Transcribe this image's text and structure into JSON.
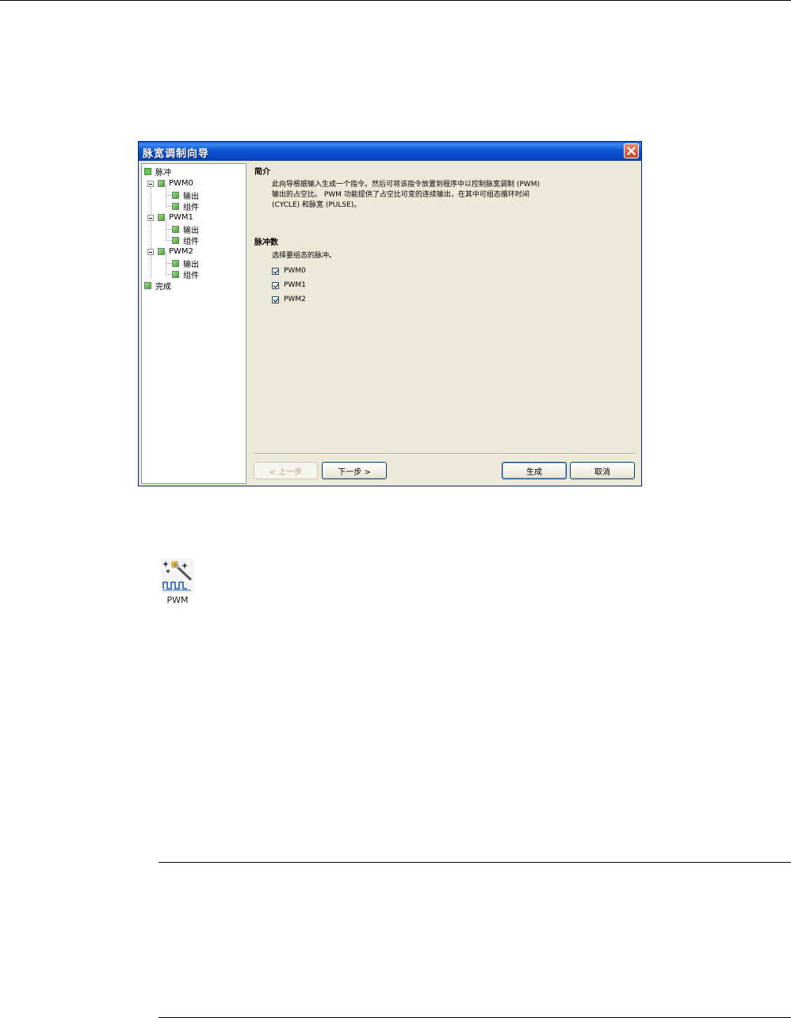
{
  "window": {
    "title": "脉宽调制向导",
    "tree": [
      {
        "label": "脉冲",
        "level": 0,
        "checked": true
      },
      {
        "label": "PWM0",
        "level": 1
      },
      {
        "label": "输出",
        "level": 2
      },
      {
        "label": "组件",
        "level": 2
      },
      {
        "label": "PWM1",
        "level": 1
      },
      {
        "label": "输出",
        "level": 2
      },
      {
        "label": "组件",
        "level": 2
      },
      {
        "label": "PWM2",
        "level": 1
      },
      {
        "label": "输出",
        "level": 2
      },
      {
        "label": "组件",
        "level": 2
      },
      {
        "label": "完成",
        "level": 0
      }
    ],
    "intro": {
      "title": "简介",
      "lines": [
        "此向导根据输入生成一个指令。然后可将该指令放置到程序中以控制脉宽调制 (PWM)",
        "输出的占空比。 PWM 功能提供了占空比可变的连续输出，在其中可组态循环时间",
        "(CYCLE) 和脉宽 (PULSE)。"
      ]
    },
    "pulses": {
      "title": "脉冲数",
      "prompt": "选择要组态的脉冲。",
      "options": [
        {
          "label": "PWM0",
          "checked": true
        },
        {
          "label": "PWM1",
          "checked": true
        },
        {
          "label": "PWM2",
          "checked": true
        }
      ]
    },
    "buttons": {
      "prev": "< 上一步",
      "next": "下一步 >",
      "generate": "生成",
      "cancel": "取消"
    }
  },
  "icon": {
    "name": "pwm-wizard-icon",
    "label": "PWM"
  }
}
